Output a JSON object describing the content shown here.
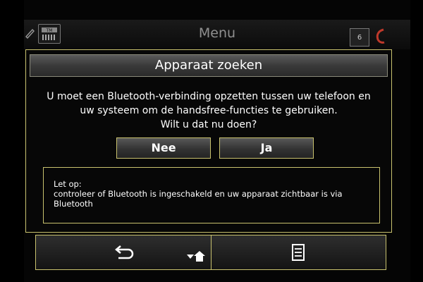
{
  "topbar": {
    "title": "Menu",
    "left_icon_label": "TM",
    "right_badge": "6"
  },
  "dialog": {
    "title": "Apparaat zoeken",
    "message_line1": "U moet een Bluetooth-verbinding opzetten tussen uw telefoon en",
    "message_line2": "uw systeem om de handsfree-functies te gebruiken.",
    "question": "Wilt u dat nu doen?",
    "no_label": "Nee",
    "yes_label": "Ja",
    "note_heading": "Let op:",
    "note_line1": "controleer of Bluetooth is ingeschakeld en uw apparaat zichtbaar is via",
    "note_line2": "Bluetooth"
  },
  "bottombar": {
    "icons": [
      "back-icon",
      "home-icon",
      "list-icon"
    ]
  },
  "colors": {
    "accent": "#c9c26e",
    "background": "#050505",
    "text": "#ffffff",
    "muted": "#8f8f8f"
  }
}
